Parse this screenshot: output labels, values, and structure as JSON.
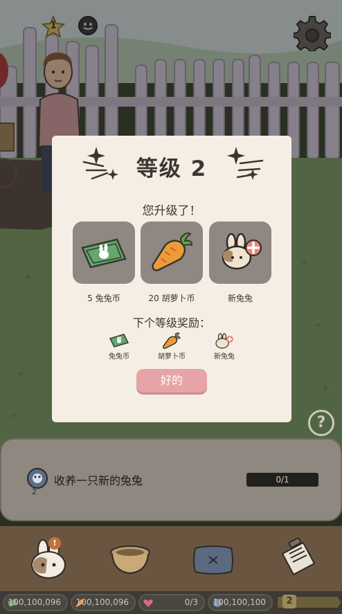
{
  "hud": {
    "star_level": "1",
    "settings_icon": "gear-icon"
  },
  "modal": {
    "title": "等级 2",
    "subtitle": "您升级了！",
    "rewards": [
      {
        "label": "5 兔兔币",
        "icon": "bunny-coin-icon"
      },
      {
        "label": "20 胡萝卜币",
        "icon": "carrot-icon"
      },
      {
        "label": "新兔兔",
        "icon": "new-bunny-icon"
      }
    ],
    "next_title": "下个等级奖励：",
    "next_rewards": [
      {
        "label": "兔兔币",
        "icon": "bunny-coin-icon"
      },
      {
        "label": "胡萝卜币",
        "icon": "carrot-icon"
      },
      {
        "label": "新兔兔",
        "icon": "new-bunny-icon"
      }
    ],
    "ok_label": "好的"
  },
  "help_label": "?",
  "quest": {
    "icon_count": "2",
    "text": "收养一只新的兔兔",
    "progress": "0/1",
    "progress_fraction": 0
  },
  "nav": {
    "badge": "!"
  },
  "currency": {
    "coins": "100,100,096",
    "carrots": "100,100,096",
    "hearts": "0/3",
    "gems": "100,100,100",
    "level": "2"
  },
  "colors": {
    "modal_bg": "#f5eee4",
    "reward_box": "#8f8781",
    "ok_button": "#e7a4a7",
    "grass": "#3b4a2c"
  }
}
